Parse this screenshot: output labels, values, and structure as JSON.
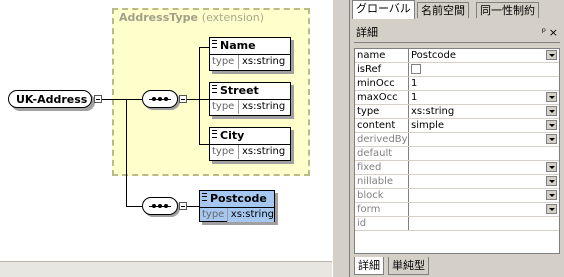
{
  "diagram": {
    "root_element": "UK-Address",
    "complex_type": {
      "name": "AddressType",
      "derivation": "(extension)"
    },
    "base_elements": [
      {
        "name": "Name",
        "type_key": "type",
        "type_value": "xs:string"
      },
      {
        "name": "Street",
        "type_key": "type",
        "type_value": "xs:string"
      },
      {
        "name": "City",
        "type_key": "type",
        "type_value": "xs:string"
      }
    ],
    "extension_element": {
      "name": "Postcode",
      "type_key": "type",
      "type_value": "xs:string",
      "selected": true
    }
  },
  "panel": {
    "top_tabs": [
      "グローバル",
      "名前空間",
      "同一性制約"
    ],
    "active_top_tab": "グローバル",
    "title": "詳細",
    "pin_icon": "pin-icon",
    "close_icon": "close-icon",
    "properties": [
      {
        "key": "name",
        "value": "Postcode",
        "dropdown": true
      },
      {
        "key": "isRef",
        "value": "",
        "checkbox": true
      },
      {
        "key": "minOcc",
        "value": "1"
      },
      {
        "key": "maxOcc",
        "value": "1",
        "dropdown": true
      },
      {
        "key": "type",
        "value": "xs:string",
        "dropdown": true
      },
      {
        "key": "content",
        "value": "simple",
        "dropdown": true
      },
      {
        "key": "derivedBy",
        "value": "",
        "dropdown": true,
        "gray": true
      },
      {
        "key": "default",
        "value": "",
        "gray": true
      },
      {
        "key": "fixed",
        "value": "",
        "dropdown": true,
        "gray": true
      },
      {
        "key": "nillable",
        "value": "",
        "dropdown": true,
        "gray": true
      },
      {
        "key": "block",
        "value": "",
        "dropdown": true,
        "gray": true
      },
      {
        "key": "form",
        "value": "",
        "dropdown": true,
        "gray": true
      },
      {
        "key": "id",
        "value": "",
        "gray": true
      }
    ],
    "bottom_tabs": [
      "詳細",
      "単純型"
    ],
    "active_bottom_tab": "詳細"
  }
}
